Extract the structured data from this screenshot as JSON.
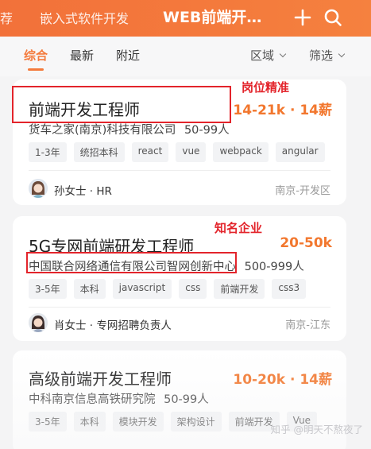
{
  "header": {
    "categories_partial": "荐",
    "category_embedded": "嵌入式软件开发",
    "category_active": "WEB前端开…",
    "plus_icon": "plus-icon",
    "search_icon": "search-icon"
  },
  "filters": {
    "tabs": [
      "综合",
      "最新",
      "附近"
    ],
    "region_label": "区域",
    "filter_label": "筛选",
    "accent_color": "#f47a3c"
  },
  "annotations": {
    "accurate_position": "岗位精准",
    "famous_company": "知名企业",
    "box_color": "#e3242b"
  },
  "jobs": [
    {
      "title": "前端开发工程师",
      "salary": "14-21k · 14薪",
      "company": "货车之家(南京)科技有限公司",
      "company_size": "50-99人",
      "tags": [
        "1-3年",
        "统招本科",
        "react",
        "vue",
        "webpack",
        "angular"
      ],
      "recruiter": "孙女士 · HR",
      "location": "南京-开发区"
    },
    {
      "title": "5G专网前端研发工程师",
      "salary": "20-50k",
      "company": "中国联合网络通信有限公司智网创新中心",
      "company_size": "500-999人",
      "tags": [
        "3-5年",
        "本科",
        "javascript",
        "css",
        "前端开发",
        "css3"
      ],
      "recruiter": "肖女士 · 专网招聘负责人",
      "location": "南京-江东"
    },
    {
      "title": "高级前端开发工程师",
      "salary": "10-20k · 14薪",
      "company": "中科南京信息高铁研究院",
      "company_size": "50-99人",
      "tags": [
        "3-5年",
        "本科",
        "模块开发",
        "架构设计",
        "前端开发",
        "Vue"
      ]
    }
  ],
  "watermark": "知乎 @明天不熬夜了"
}
